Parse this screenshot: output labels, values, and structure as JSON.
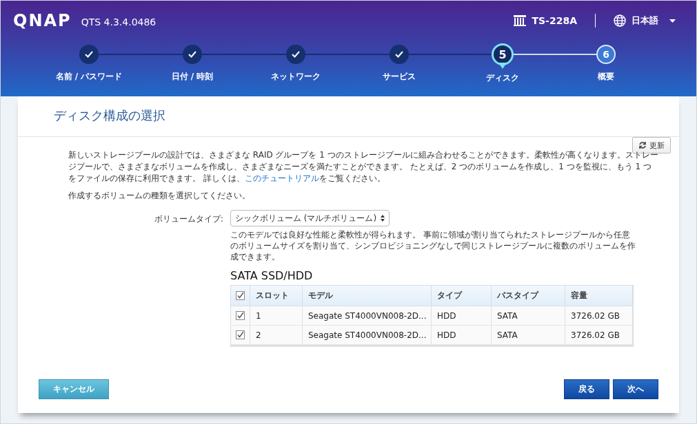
{
  "top_bar": {
    "logo": "QNAP",
    "version": "QTS 4.3.4.0486",
    "device": "TS-228A",
    "language": "日本語"
  },
  "steps": [
    {
      "label": "名前 / パスワード",
      "done": true,
      "selected": false
    },
    {
      "label": "日付 / 時刻",
      "done": true,
      "selected": false
    },
    {
      "label": "ネットワーク",
      "done": true,
      "selected": false
    },
    {
      "label": "サービス",
      "done": true,
      "selected": false
    },
    {
      "number": "5",
      "label": "ディスク",
      "done": false,
      "selected": true
    },
    {
      "number": "6",
      "label": "概要",
      "done": false,
      "selected": false
    }
  ],
  "panel": {
    "title": "ディスク構成の選択",
    "refresh_button": "更新",
    "intro": "新しいストレージプールの設計では、さまざまな RAID グループを 1 つのストレージプールに組み合わせることができます。柔軟性が高くなります。ストレージプールで、さまざまなボリュームを作成し、さまざまなニーズを満たすことができます。 たとえば、2 つのボリュームを作成し、1 つを監視に、もう 1 つをファイルの保存に利用できます。 詳しくは、",
    "intro_link": "このチュートリアル",
    "intro_end": "をご覧ください。",
    "prompt": "作成するボリュームの種類を選択してください。",
    "volume_type": {
      "label": "ボリュームタイプ:",
      "value": "シックボリューム (マルチボリューム)",
      "description": "このモデルでは良好な性能と柔軟性が得られます。 事前に領域が割り当てられたストレージプールから任意のボリュームサイズを割り当て、シンプロビジョニングなしで同じストレージプールに複数のボリュームを作成できます。"
    },
    "disk_section": "SATA SSD/HDD",
    "table": {
      "all_checked": true,
      "columns": [
        "スロット",
        "モデル",
        "タイプ",
        "バスタイプ",
        "容量"
      ],
      "rows": [
        {
          "checked": true,
          "cells": [
            "1",
            "Seagate ST4000VN008-2D...",
            "HDD",
            "SATA",
            "3726.02 GB"
          ]
        },
        {
          "checked": true,
          "cells": [
            "2",
            "Seagate ST4000VN008-2D...",
            "HDD",
            "SATA",
            "3726.02 GB"
          ]
        }
      ]
    }
  },
  "buttons": {
    "cancel": "キャンセル",
    "back": "戻る",
    "next": "次へ"
  }
}
